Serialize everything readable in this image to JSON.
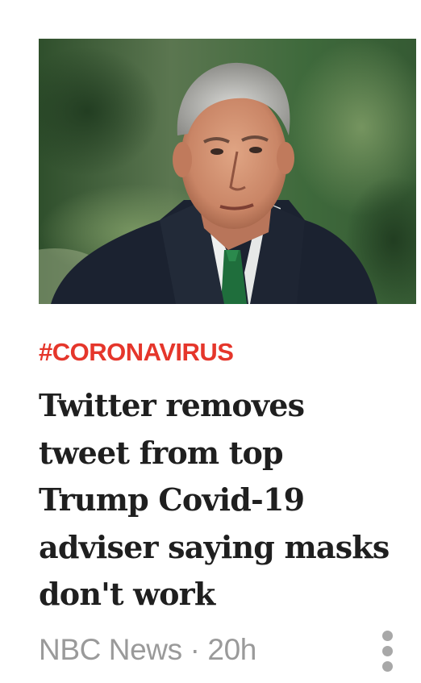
{
  "article": {
    "image_alt": "Gray-haired man in dark suit, white shirt and green tie",
    "tag": "#CORONAVIRUS",
    "headline": "Twitter removes tweet from top Trump Covid-19 adviser saying masks don't work",
    "source": "NBC News",
    "separator": " · ",
    "age": "20h",
    "more_icon": "more-vertical-icon"
  },
  "colors": {
    "tag": "#e5362b",
    "headline": "#1f1f1f",
    "meta": "#9a9a9a",
    "dots": "#a8a8a8"
  }
}
